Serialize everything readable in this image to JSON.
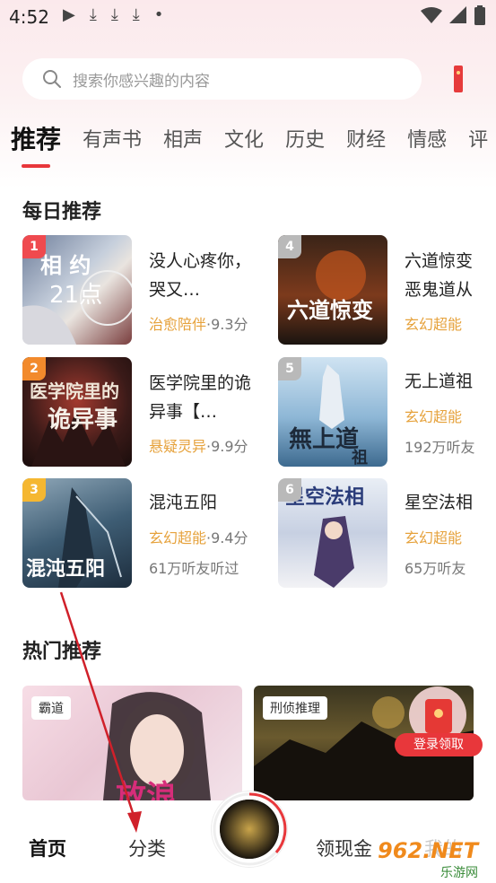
{
  "status_bar": {
    "time": "4:52",
    "dot": "•"
  },
  "search": {
    "placeholder": "搜索你感兴趣的内容"
  },
  "tabs": [
    {
      "label": "推荐",
      "active": true
    },
    {
      "label": "有声书"
    },
    {
      "label": "相声"
    },
    {
      "label": "文化"
    },
    {
      "label": "历史"
    },
    {
      "label": "财经"
    },
    {
      "label": "情感"
    },
    {
      "label": "评"
    }
  ],
  "daily": {
    "title": "每日推荐",
    "books": [
      {
        "rank": "1",
        "title": "没人心疼你，哭又…",
        "genre": "治愈陪伴",
        "score": "·9.3分",
        "listeners": "",
        "cover_text": "相 约 21点"
      },
      {
        "rank": "2",
        "title": "医学院里的诡异事【…",
        "genre": "悬疑灵异",
        "score": "·9.9分",
        "listeners": "",
        "cover_text": "医学院里的诡异事"
      },
      {
        "rank": "3",
        "title": "混沌五阳",
        "genre": "玄幻超能",
        "score": "·9.4分",
        "listeners": "61万听友听过",
        "cover_text": "混沌五阳"
      },
      {
        "rank": "4",
        "title": "六道惊变恶鬼道从",
        "genre": "玄幻超能",
        "score": "",
        "listeners": "",
        "cover_text": "六道惊变"
      },
      {
        "rank": "5",
        "title": "无上道祖",
        "genre": "玄幻超能",
        "score": "",
        "listeners": "192万听友",
        "cover_text": "無上道祖"
      },
      {
        "rank": "6",
        "title": "星空法相",
        "genre": "玄幻超能",
        "score": "",
        "listeners": "65万听友",
        "cover_text": "星空法相"
      }
    ]
  },
  "hot": {
    "title": "热门推荐",
    "cards": [
      {
        "tag": "霸道",
        "cover_text": "放浪"
      },
      {
        "tag": "刑侦推理",
        "cover_text": ""
      }
    ],
    "redpacket_label": "登录领取"
  },
  "nav": {
    "home": "首页",
    "category": "分类",
    "cash": "领现金",
    "mine": "我的"
  },
  "watermark": {
    "brand": "962.NET",
    "sub": "乐游网"
  },
  "colors": {
    "accent": "#e8373b",
    "genre": "#e6a23c",
    "annotation_arrow": "#d0202a"
  }
}
